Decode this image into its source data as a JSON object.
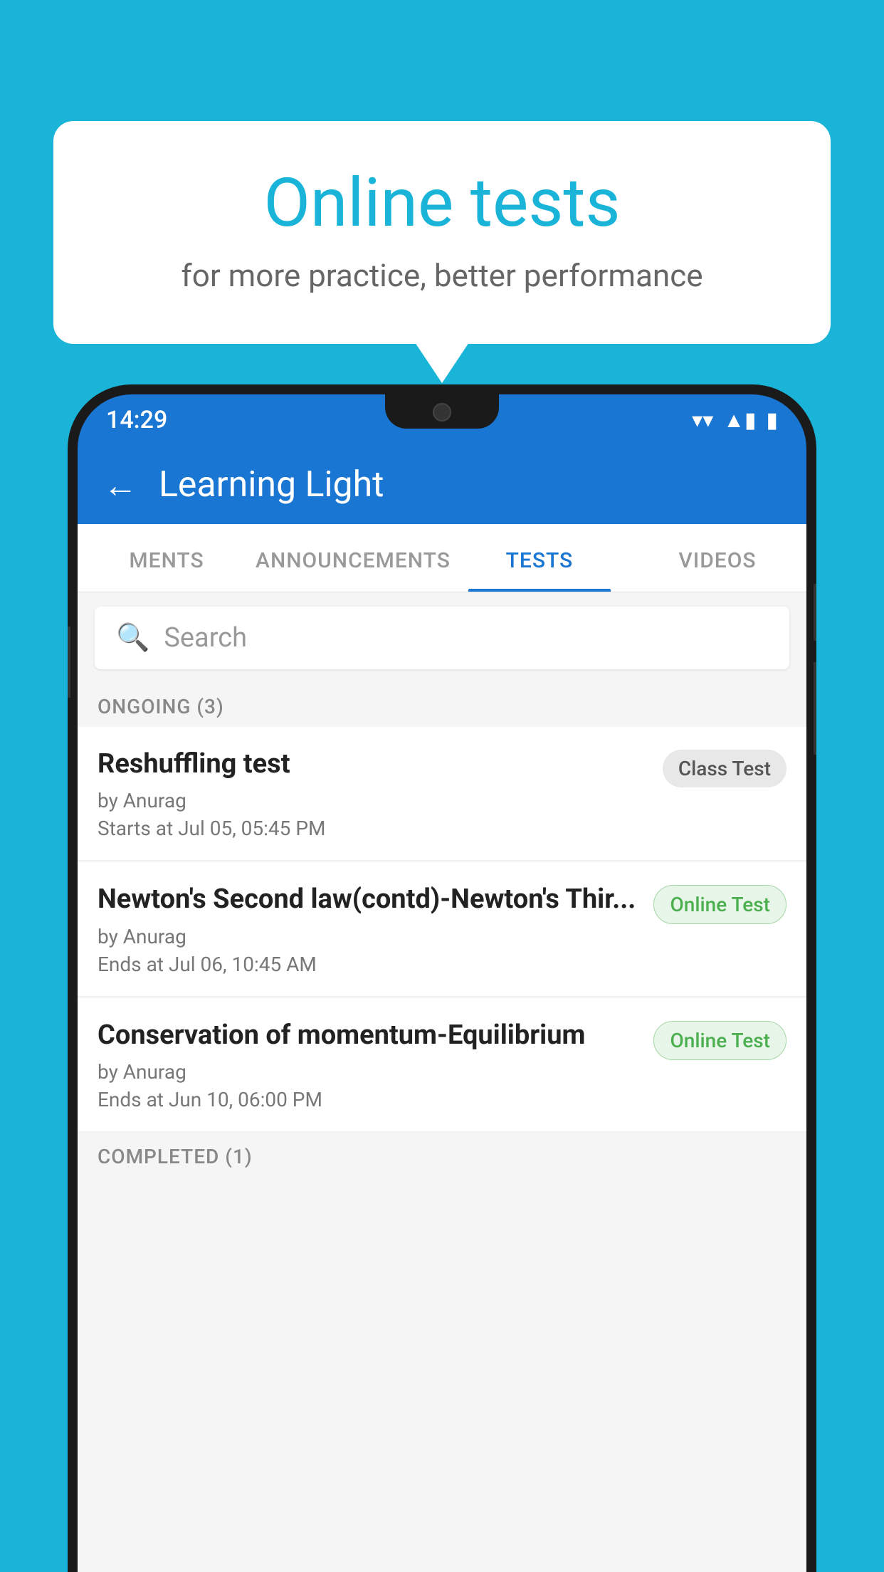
{
  "background_color": "#1ab4d8",
  "bubble": {
    "title": "Online tests",
    "subtitle": "for more practice, better performance"
  },
  "status_bar": {
    "time": "14:29",
    "wifi": "▼",
    "signal": "▲",
    "battery": "▮"
  },
  "header": {
    "back_label": "←",
    "title": "Learning Light"
  },
  "tabs": [
    {
      "label": "MENTS",
      "active": false
    },
    {
      "label": "ANNOUNCEMENTS",
      "active": false
    },
    {
      "label": "TESTS",
      "active": true
    },
    {
      "label": "VIDEOS",
      "active": false
    }
  ],
  "search": {
    "placeholder": "Search"
  },
  "ongoing": {
    "header": "ONGOING (3)",
    "items": [
      {
        "title": "Reshuffling test",
        "by": "by Anurag",
        "time": "Starts at  Jul 05, 05:45 PM",
        "badge": "Class Test",
        "badge_type": "class"
      },
      {
        "title": "Newton's Second law(contd)-Newton's Thir...",
        "by": "by Anurag",
        "time": "Ends at  Jul 06, 10:45 AM",
        "badge": "Online Test",
        "badge_type": "online"
      },
      {
        "title": "Conservation of momentum-Equilibrium",
        "by": "by Anurag",
        "time": "Ends at  Jun 10, 06:00 PM",
        "badge": "Online Test",
        "badge_type": "online"
      }
    ]
  },
  "completed": {
    "header": "COMPLETED (1)"
  }
}
